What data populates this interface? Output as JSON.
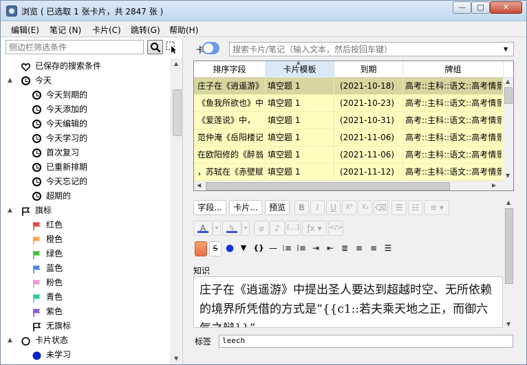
{
  "window": {
    "title": "浏览 ( 已选取 1 张卡片，共 2847 张 )",
    "controls": {
      "minimize": "—",
      "maximize": "□",
      "close": "✕"
    }
  },
  "menu": [
    "编辑(E)",
    "笔记 (N)",
    "卡片(C)",
    "跳转(G)",
    "帮助(H)"
  ],
  "sidebar": {
    "filter_placeholder": "侧边栏筛选条件",
    "items": [
      {
        "label": "已保存的搜索条件",
        "icon": "heart-icon",
        "level": 0,
        "caret": ""
      },
      {
        "label": "今天",
        "icon": "clock-icon",
        "level": 0,
        "caret": "▲"
      },
      {
        "label": "今天到期的",
        "icon": "clock-icon",
        "level": 1,
        "caret": ""
      },
      {
        "label": "今天添加的",
        "icon": "clock-icon",
        "level": 1,
        "caret": ""
      },
      {
        "label": "今天编辑的",
        "icon": "clock-icon",
        "level": 1,
        "caret": ""
      },
      {
        "label": "今天学习的",
        "icon": "clock-icon",
        "level": 1,
        "caret": ""
      },
      {
        "label": "首次复习",
        "icon": "clock-icon",
        "level": 1,
        "caret": ""
      },
      {
        "label": "已重新排期",
        "icon": "clock-icon",
        "level": 1,
        "caret": ""
      },
      {
        "label": "今天忘记的",
        "icon": "clock-icon",
        "level": 1,
        "caret": ""
      },
      {
        "label": "超期的",
        "icon": "clock-icon",
        "level": 1,
        "caret": ""
      },
      {
        "label": "旗标",
        "icon": "flag-outline-icon",
        "level": 0,
        "caret": "▲"
      },
      {
        "label": "红色",
        "icon": "flag-icon",
        "color": "#e8413d",
        "level": 1,
        "caret": ""
      },
      {
        "label": "橙色",
        "icon": "flag-icon",
        "color": "#f7a43e",
        "level": 1,
        "caret": ""
      },
      {
        "label": "绿色",
        "icon": "flag-icon",
        "color": "#3ec232",
        "level": 1,
        "caret": ""
      },
      {
        "label": "蓝色",
        "icon": "flag-icon",
        "color": "#4c86e8",
        "level": 1,
        "caret": ""
      },
      {
        "label": "粉色",
        "icon": "flag-icon",
        "color": "#f092d8",
        "level": 1,
        "caret": ""
      },
      {
        "label": "青色",
        "icon": "flag-icon",
        "color": "#1ecba1",
        "level": 1,
        "caret": ""
      },
      {
        "label": "紫色",
        "icon": "flag-icon",
        "color": "#8d53d6",
        "level": 1,
        "caret": ""
      },
      {
        "label": "无旗标",
        "icon": "flag-outline-icon",
        "level": 1,
        "caret": ""
      },
      {
        "label": "卡片状态",
        "icon": "circle-icon",
        "level": 0,
        "caret": "▲"
      },
      {
        "label": "未学习",
        "icon": "new-dot-icon",
        "color": "#0a22c8",
        "level": 1,
        "caret": ""
      }
    ]
  },
  "search": {
    "toggle_label": "卡",
    "placeholder": "搜索卡片/笔记（输入文本，然后按回车键）"
  },
  "table": {
    "columns": [
      "排序字段",
      "卡片模板",
      "到期",
      "牌组"
    ],
    "rows": [
      [
        "庄子在《逍遥游》中提出圣人要达到超越时空",
        "填空题 1",
        "(2021-10-18)",
        "高考::主科::语文::高考情景默写"
      ],
      [
        "《鱼我所欲也》中，孟子",
        "填空题 1",
        "(2021-10-23)",
        "高考::主科::语文::高考情景默写"
      ],
      [
        "《爱莲说》中，",
        "填空题 1",
        "(2021-10-31)",
        "高考::主科::语文::高考情景默写"
      ],
      [
        "范仲淹《岳阳楼记》中",
        "填空题 1",
        "(2021-11-06)",
        "高考::主科::语文::高考情景默写"
      ],
      [
        "在欧阳修的《醉翁亭记》中",
        "填空题 1",
        "(2021-11-06)",
        "高考::主科::语文::高考情景默写"
      ],
      [
        "，苏轼在《赤壁赋》中",
        "填空题 1",
        "(2021-11-12)",
        "高考::主科::语文::高考情景默写"
      ]
    ]
  },
  "editor": {
    "row1": [
      "字段...",
      "卡片...",
      "预览"
    ],
    "format_buttons": [
      "B",
      "I",
      "U",
      "X²",
      "X₂"
    ],
    "field_label": "知识",
    "field_text": "庄子在《逍遥游》中提出圣人要达到超越时空、无所依赖的境界所凭借的方式是“{{c1::若夫乘天地之正，而御六气之辩}}”",
    "tags_label": "标签",
    "tags_value": "leech"
  },
  "colors": {
    "row_bg": "#fefcbe",
    "row_selected": "#d8d6a0",
    "accent": "#6a9be8"
  }
}
